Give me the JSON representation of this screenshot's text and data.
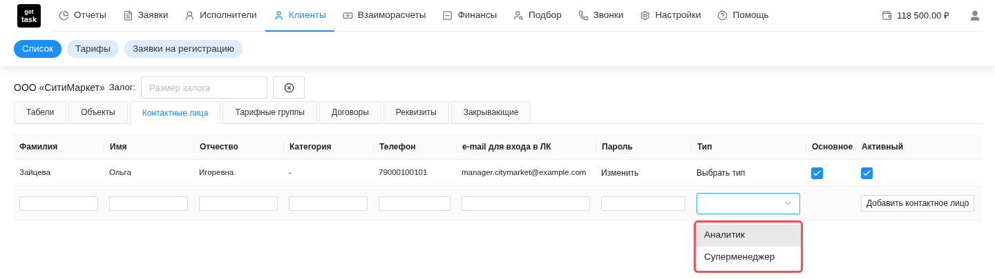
{
  "nav": {
    "logo_top": "get",
    "logo_bottom": "task",
    "items": [
      {
        "label": "Отчеты",
        "selected": false
      },
      {
        "label": "Заявки",
        "selected": false
      },
      {
        "label": "Исполнители",
        "selected": false
      },
      {
        "label": "Клиенты",
        "selected": true
      },
      {
        "label": "Взаиморасчеты",
        "selected": false
      },
      {
        "label": "Финансы",
        "selected": false
      },
      {
        "label": "Подбор",
        "selected": false
      },
      {
        "label": "Звонки",
        "selected": false
      },
      {
        "label": "Настройки",
        "selected": false
      },
      {
        "label": "Помощь",
        "selected": false
      }
    ],
    "balance": "118 500.00 ₽"
  },
  "subtabs": [
    {
      "label": "Список",
      "selected": true
    },
    {
      "label": "Тарифы",
      "selected": false
    },
    {
      "label": "Заявки на регистрацию",
      "selected": false
    }
  ],
  "client": {
    "name": "ООО «СитиМаркет»",
    "deposit_label": "Залог:",
    "deposit_placeholder": "Размер залога"
  },
  "tabs": [
    {
      "label": "Табели",
      "selected": false
    },
    {
      "label": "Объекты",
      "selected": false
    },
    {
      "label": "Контактные лица",
      "selected": true
    },
    {
      "label": "Тарифные группы",
      "selected": false
    },
    {
      "label": "Договоры",
      "selected": false
    },
    {
      "label": "Реквизиты",
      "selected": false
    },
    {
      "label": "Закрывающие",
      "selected": false
    }
  ],
  "table": {
    "columns": [
      "Фамилия",
      "Имя",
      "Отчество",
      "Категория",
      "Телефон",
      "e-mail для входа в ЛК",
      "Пароль",
      "Тип",
      "Основное",
      "Активный"
    ],
    "rows": [
      {
        "last_name": "Зайцева",
        "first_name": "Ольга",
        "middle_name": "Игоревна",
        "category": "-",
        "phone": "79000100101",
        "email": "manager.citymarket@example.com",
        "password": "Изменить",
        "type": "Выбрать тип",
        "main": true,
        "active": true
      }
    ]
  },
  "new_row": {
    "add_button": "Добавить контактное лицо"
  },
  "type_dropdown": {
    "options": [
      {
        "label": "Аналитик",
        "highlighted": true
      },
      {
        "label": "Суперменеджер",
        "highlighted": false
      }
    ]
  }
}
